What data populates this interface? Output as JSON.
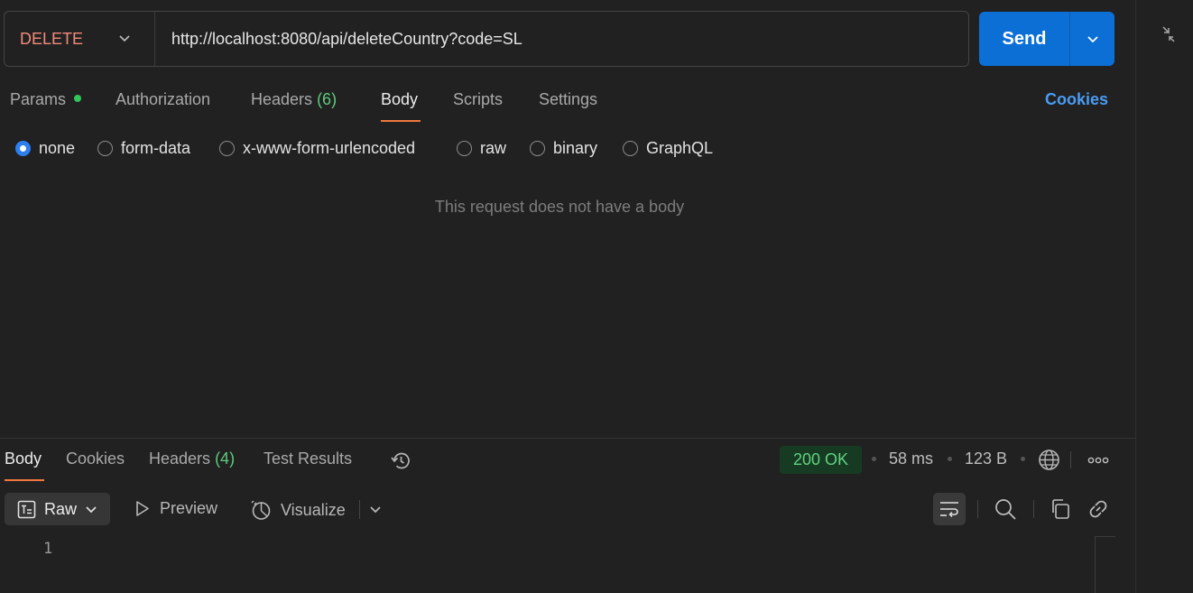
{
  "request": {
    "method": "DELETE",
    "url": "http://localhost:8080/api/deleteCountry?code=SL",
    "send_label": "Send"
  },
  "request_tabs": {
    "params": "Params",
    "authorization": "Authorization",
    "headers": "Headers",
    "headers_count": "(6)",
    "body": "Body",
    "scripts": "Scripts",
    "settings": "Settings",
    "cookies": "Cookies"
  },
  "body_options": {
    "selected": "none",
    "none": "none",
    "form_data": "form-data",
    "urlencoded": "x-www-form-urlencoded",
    "raw": "raw",
    "binary": "binary",
    "graphql": "GraphQL"
  },
  "empty_body_message": "This request does not have a body",
  "response": {
    "tabs": {
      "body": "Body",
      "cookies": "Cookies",
      "headers": "Headers",
      "headers_count": "(4)",
      "test_results": "Test Results"
    },
    "status": "200 OK",
    "time": "58 ms",
    "size": "123 B",
    "format": "Raw",
    "preview": "Preview",
    "visualize": "Visualize",
    "line_numbers": [
      "1"
    ]
  },
  "colors": {
    "method": "#f28a7b",
    "send": "#0b6fd6",
    "accent_underline": "#f0773e",
    "status_ok_bg": "#173a23",
    "status_ok_text": "#5fd37f",
    "link": "#4a9cf3"
  },
  "icons": [
    "chevron-down-icon",
    "collapse-icon",
    "history-icon",
    "globe-icon",
    "more-icon",
    "raw-format-icon",
    "play-icon",
    "visualize-icon",
    "wrap-lines-icon",
    "search-icon",
    "copy-icon",
    "link-icon"
  ]
}
